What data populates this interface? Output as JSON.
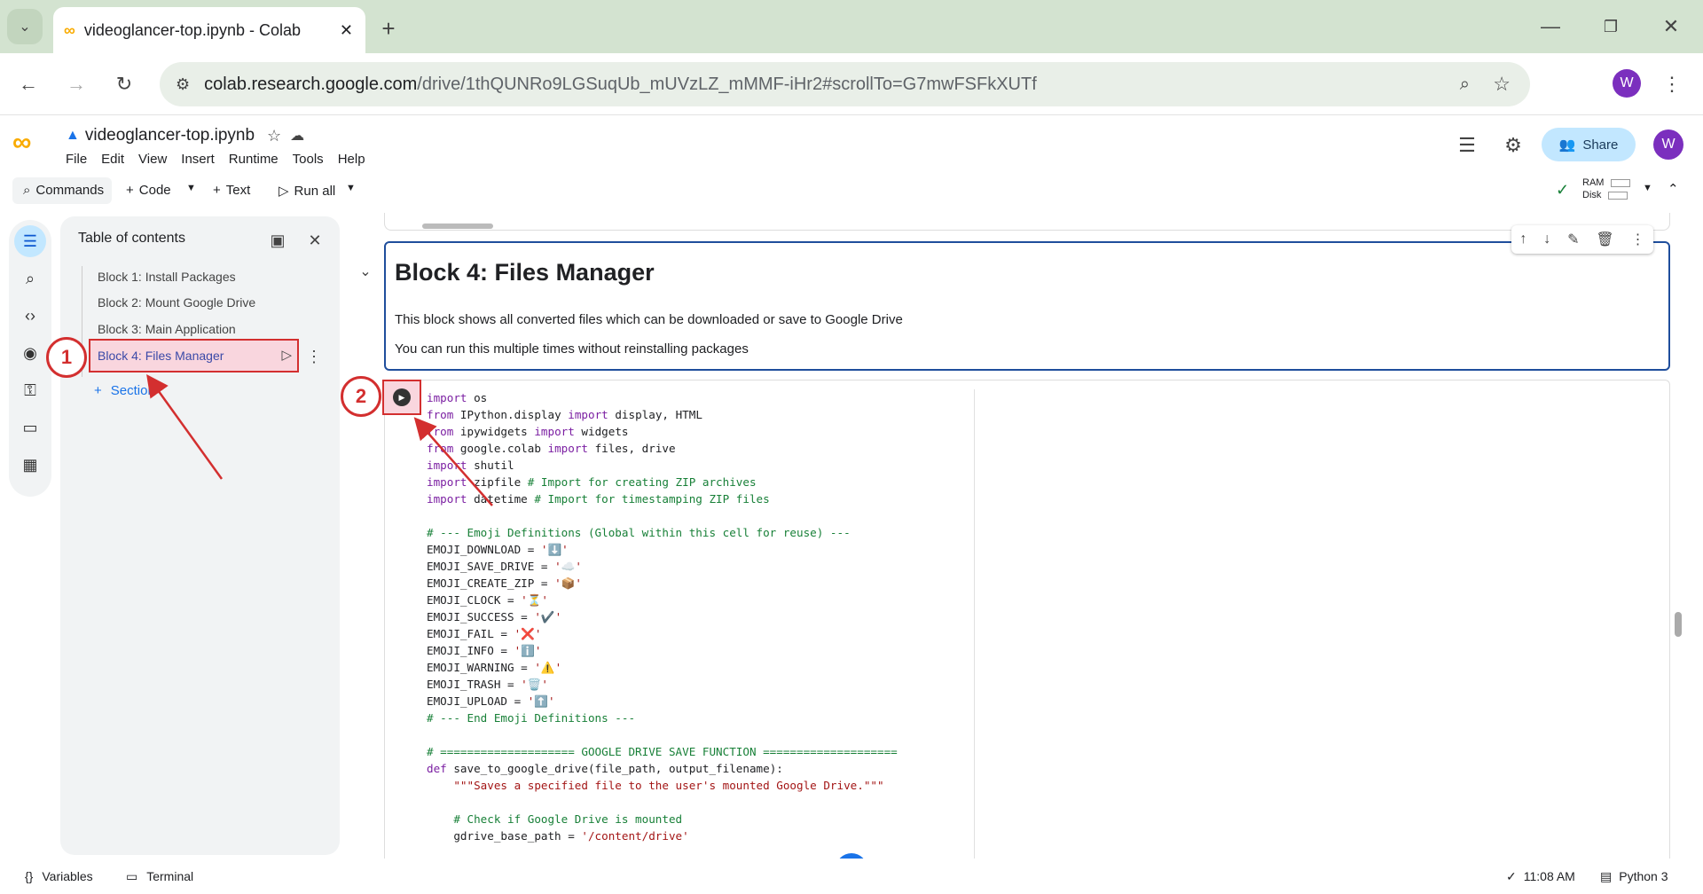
{
  "browser": {
    "tab_title": "videoglancer-top.ipynb - Colab",
    "url_host": "colab.research.google.com",
    "url_path": "/drive/1thQUNRo9LGSuqUb_mUVzLZ_mMMF-iHr2#scrollTo=G7mwFSFkXUTf",
    "profile_initial": "W"
  },
  "colab": {
    "notebook_name": "videoglancer-top.ipynb",
    "menu": [
      "File",
      "Edit",
      "View",
      "Insert",
      "Runtime",
      "Tools",
      "Help"
    ],
    "share_label": "Share",
    "avatar_initial": "W",
    "toolbar": {
      "commands": "Commands",
      "code": "Code",
      "text": "Text",
      "run_all": "Run all",
      "ram": "RAM",
      "disk": "Disk"
    }
  },
  "toc": {
    "title": "Table of contents",
    "items": [
      "Block 1: Install Packages",
      "Block 2: Mount Google Drive",
      "Block 3: Main Application",
      "Block 4: Files Manager"
    ],
    "add_section": "Section"
  },
  "annotations": {
    "marker1": "1",
    "marker2": "2"
  },
  "markdown_cell": {
    "heading": "Block 4: Files Manager",
    "line1": "This block shows all converted files which can be downloaded or save to Google Drive",
    "line2": "You can run this multiple times without reinstalling packages"
  },
  "code_lines": [
    [
      [
        "kw",
        "import"
      ],
      [
        "fn",
        " os"
      ]
    ],
    [
      [
        "kw",
        "from"
      ],
      [
        "fn",
        " IPython.display "
      ],
      [
        "kw",
        "import"
      ],
      [
        "fn",
        " display, HTML"
      ]
    ],
    [
      [
        "kw",
        "from"
      ],
      [
        "fn",
        " ipywidgets "
      ],
      [
        "kw",
        "import"
      ],
      [
        "fn",
        " widgets"
      ]
    ],
    [
      [
        "kw",
        "from"
      ],
      [
        "fn",
        " google.colab "
      ],
      [
        "kw",
        "import"
      ],
      [
        "fn",
        " files, drive"
      ]
    ],
    [
      [
        "kw",
        "import"
      ],
      [
        "fn",
        " shutil"
      ]
    ],
    [
      [
        "kw",
        "import"
      ],
      [
        "fn",
        " zipfile "
      ],
      [
        "cm",
        "# Import for creating ZIP archives"
      ]
    ],
    [
      [
        "kw",
        "import"
      ],
      [
        "fn",
        " datetime "
      ],
      [
        "cm",
        "# Import for timestamping ZIP files"
      ]
    ],
    [
      [
        "fn",
        ""
      ]
    ],
    [
      [
        "cm",
        "# --- Emoji Definitions (Global within this cell for reuse) ---"
      ]
    ],
    [
      [
        "fn",
        "EMOJI_DOWNLOAD = "
      ],
      [
        "st",
        "'⬇️'"
      ]
    ],
    [
      [
        "fn",
        "EMOJI_SAVE_DRIVE = "
      ],
      [
        "st",
        "'☁️'"
      ]
    ],
    [
      [
        "fn",
        "EMOJI_CREATE_ZIP = "
      ],
      [
        "st",
        "'📦'"
      ]
    ],
    [
      [
        "fn",
        "EMOJI_CLOCK = "
      ],
      [
        "st",
        "'⏳'"
      ]
    ],
    [
      [
        "fn",
        "EMOJI_SUCCESS = "
      ],
      [
        "st",
        "'✔️'"
      ]
    ],
    [
      [
        "fn",
        "EMOJI_FAIL = "
      ],
      [
        "st",
        "'❌'"
      ]
    ],
    [
      [
        "fn",
        "EMOJI_INFO = "
      ],
      [
        "st",
        "'ℹ️'"
      ]
    ],
    [
      [
        "fn",
        "EMOJI_WARNING = "
      ],
      [
        "st",
        "'⚠️'"
      ]
    ],
    [
      [
        "fn",
        "EMOJI_TRASH = "
      ],
      [
        "st",
        "'🗑️'"
      ]
    ],
    [
      [
        "fn",
        "EMOJI_UPLOAD = "
      ],
      [
        "st",
        "'⬆️'"
      ]
    ],
    [
      [
        "cm",
        "# --- End Emoji Definitions ---"
      ]
    ],
    [
      [
        "fn",
        ""
      ]
    ],
    [
      [
        "cm",
        "# ==================== GOOGLE DRIVE SAVE FUNCTION ===================="
      ]
    ],
    [
      [
        "kw",
        "def"
      ],
      [
        "fn",
        " save_to_google_drive(file_path, output_filename):"
      ]
    ],
    [
      [
        "st",
        "    \"\"\"Saves a specified file to the user's mounted Google Drive.\"\"\""
      ]
    ],
    [
      [
        "fn",
        ""
      ]
    ],
    [
      [
        "cm",
        "    # Check if Google Drive is mounted"
      ]
    ],
    [
      [
        "fn",
        "    gdrive_base_path = "
      ],
      [
        "st",
        "'/content/drive'"
      ]
    ]
  ],
  "status": {
    "variables": "Variables",
    "terminal": "Terminal",
    "time": "11:08 AM",
    "kernel": "Python 3"
  }
}
